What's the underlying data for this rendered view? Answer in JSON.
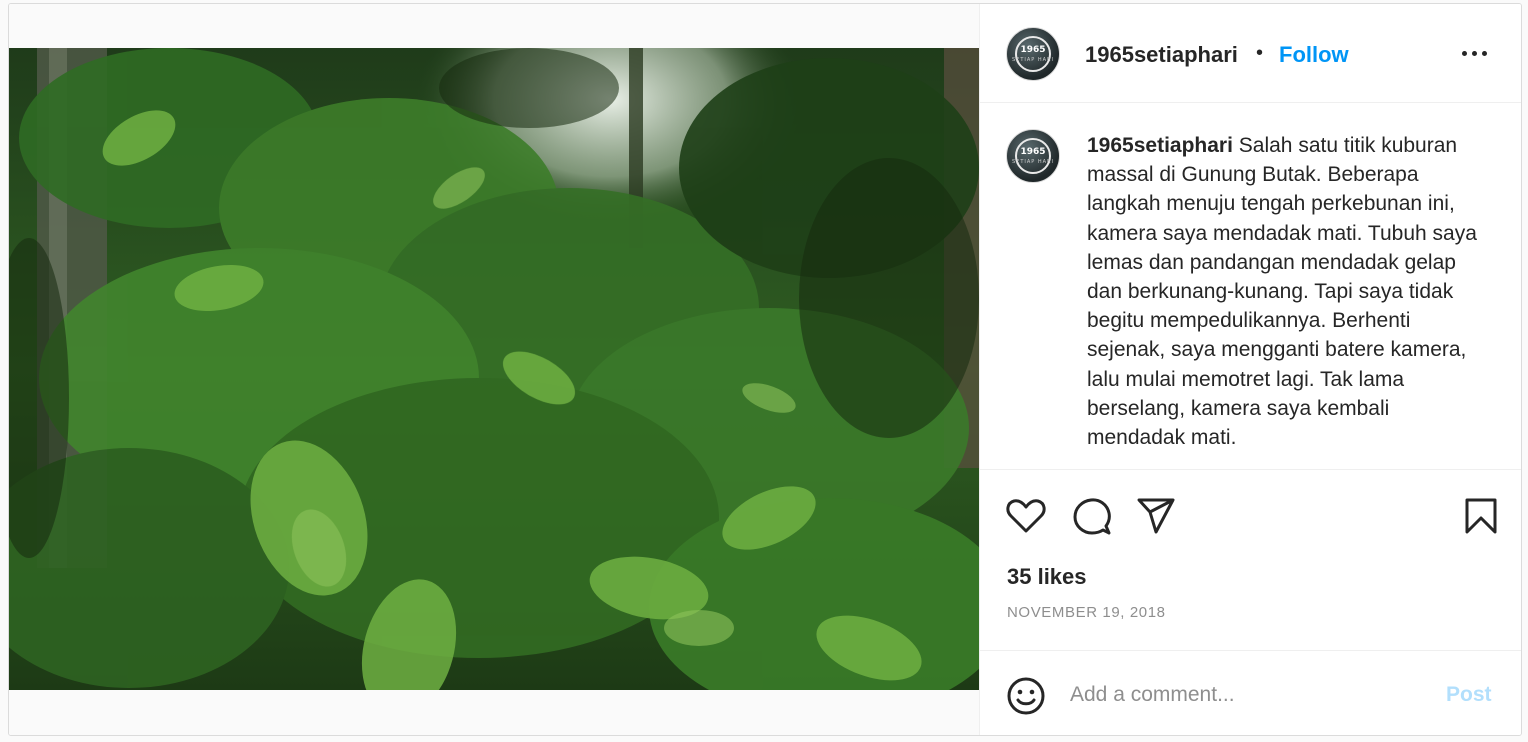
{
  "post": {
    "username": "1965setiaphari",
    "separator": "•",
    "follow_label": "Follow",
    "more_icon": "more-horizontal-icon",
    "avatar_year": "1965",
    "avatar_subtitle": "SETIAP HARI",
    "image_alt": "Dense green vegetation in a forest plantation"
  },
  "caption": {
    "username": "1965setiaphari",
    "text": "Salah satu titik kuburan massal di Gunung Butak. Beberapa langkah menuju tengah perkebunan ini, kamera saya mendadak mati. Tubuh saya lemas dan pandangan mendadak gelap dan berkunang-kunang. Tapi saya tidak begitu mempedulikannya. Berhenti sejenak, saya mengganti batere kamera, lalu mulai memotret lagi. Tak lama berselang, kamera saya kembali mendadak mati."
  },
  "actions": {
    "icons": [
      "heart-icon",
      "comment-icon",
      "share-icon",
      "bookmark-icon"
    ],
    "likes": "35 likes",
    "date": "NOVEMBER 19, 2018"
  },
  "comment": {
    "placeholder": "Add a comment...",
    "post_label": "Post",
    "emoji_icon": "emoji-icon"
  },
  "colors": {
    "link": "#0095f6",
    "post_disabled": "#b2dffc",
    "text": "#262626",
    "muted": "#8e8e8e"
  }
}
